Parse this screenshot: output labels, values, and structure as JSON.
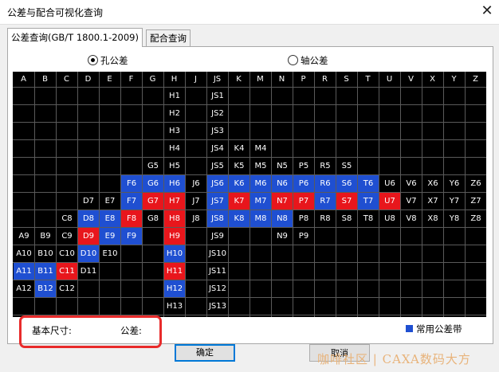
{
  "window": {
    "title": "公差与配合可视化查询",
    "close_glyph": "✕"
  },
  "tabs": [
    {
      "label": "公差查询(GB/T 1800.1-2009)",
      "active": true
    },
    {
      "label": "配合查询",
      "active": false
    }
  ],
  "radios": [
    {
      "label": "孔公差",
      "checked": true
    },
    {
      "label": "轴公差",
      "checked": false
    }
  ],
  "grid": {
    "columns": [
      "A",
      "B",
      "C",
      "D",
      "E",
      "F",
      "G",
      "H",
      "J",
      "JS",
      "K",
      "M",
      "N",
      "P",
      "R",
      "S",
      "T",
      "U",
      "V",
      "X",
      "Y",
      "Z"
    ],
    "colors": {
      "blue": "#1f4fd1",
      "red": "#e8161c"
    },
    "cells": [
      {
        "r": 0,
        "c": 7,
        "t": "H1"
      },
      {
        "r": 0,
        "c": 9,
        "t": "JS1"
      },
      {
        "r": 1,
        "c": 7,
        "t": "H2"
      },
      {
        "r": 1,
        "c": 9,
        "t": "JS2"
      },
      {
        "r": 2,
        "c": 7,
        "t": "H3"
      },
      {
        "r": 2,
        "c": 9,
        "t": "JS3"
      },
      {
        "r": 3,
        "c": 7,
        "t": "H4"
      },
      {
        "r": 3,
        "c": 9,
        "t": "JS4"
      },
      {
        "r": 3,
        "c": 10,
        "t": "K4"
      },
      {
        "r": 3,
        "c": 11,
        "t": "M4"
      },
      {
        "r": 4,
        "c": 6,
        "t": "G5"
      },
      {
        "r": 4,
        "c": 7,
        "t": "H5"
      },
      {
        "r": 4,
        "c": 9,
        "t": "JS5"
      },
      {
        "r": 4,
        "c": 10,
        "t": "K5"
      },
      {
        "r": 4,
        "c": 11,
        "t": "M5"
      },
      {
        "r": 4,
        "c": 12,
        "t": "N5"
      },
      {
        "r": 4,
        "c": 13,
        "t": "P5"
      },
      {
        "r": 4,
        "c": 14,
        "t": "R5"
      },
      {
        "r": 4,
        "c": 15,
        "t": "S5"
      },
      {
        "r": 5,
        "c": 5,
        "t": "F6",
        "k": "blue"
      },
      {
        "r": 5,
        "c": 6,
        "t": "G6",
        "k": "blue"
      },
      {
        "r": 5,
        "c": 7,
        "t": "H6",
        "k": "blue"
      },
      {
        "r": 5,
        "c": 8,
        "t": "J6"
      },
      {
        "r": 5,
        "c": 9,
        "t": "JS6",
        "k": "blue"
      },
      {
        "r": 5,
        "c": 10,
        "t": "K6",
        "k": "blue"
      },
      {
        "r": 5,
        "c": 11,
        "t": "M6",
        "k": "blue"
      },
      {
        "r": 5,
        "c": 12,
        "t": "N6",
        "k": "blue"
      },
      {
        "r": 5,
        "c": 13,
        "t": "P6",
        "k": "blue"
      },
      {
        "r": 5,
        "c": 14,
        "t": "R6",
        "k": "blue"
      },
      {
        "r": 5,
        "c": 15,
        "t": "S6",
        "k": "blue"
      },
      {
        "r": 5,
        "c": 16,
        "t": "T6",
        "k": "blue"
      },
      {
        "r": 5,
        "c": 17,
        "t": "U6"
      },
      {
        "r": 5,
        "c": 18,
        "t": "V6"
      },
      {
        "r": 5,
        "c": 19,
        "t": "X6"
      },
      {
        "r": 5,
        "c": 20,
        "t": "Y6"
      },
      {
        "r": 5,
        "c": 21,
        "t": "Z6"
      },
      {
        "r": 6,
        "c": 3,
        "t": "D7"
      },
      {
        "r": 6,
        "c": 4,
        "t": "E7"
      },
      {
        "r": 6,
        "c": 5,
        "t": "F7",
        "k": "blue"
      },
      {
        "r": 6,
        "c": 6,
        "t": "G7",
        "k": "red"
      },
      {
        "r": 6,
        "c": 7,
        "t": "H7",
        "k": "red"
      },
      {
        "r": 6,
        "c": 8,
        "t": "J7"
      },
      {
        "r": 6,
        "c": 9,
        "t": "JS7",
        "k": "blue"
      },
      {
        "r": 6,
        "c": 10,
        "t": "K7",
        "k": "red"
      },
      {
        "r": 6,
        "c": 11,
        "t": "M7",
        "k": "blue"
      },
      {
        "r": 6,
        "c": 12,
        "t": "N7",
        "k": "red"
      },
      {
        "r": 6,
        "c": 13,
        "t": "P7",
        "k": "red"
      },
      {
        "r": 6,
        "c": 14,
        "t": "R7",
        "k": "blue"
      },
      {
        "r": 6,
        "c": 15,
        "t": "S7",
        "k": "red"
      },
      {
        "r": 6,
        "c": 16,
        "t": "T7",
        "k": "blue"
      },
      {
        "r": 6,
        "c": 17,
        "t": "U7",
        "k": "red"
      },
      {
        "r": 6,
        "c": 18,
        "t": "V7"
      },
      {
        "r": 6,
        "c": 19,
        "t": "X7"
      },
      {
        "r": 6,
        "c": 20,
        "t": "Y7"
      },
      {
        "r": 6,
        "c": 21,
        "t": "Z7"
      },
      {
        "r": 7,
        "c": 2,
        "t": "C8"
      },
      {
        "r": 7,
        "c": 3,
        "t": "D8",
        "k": "blue"
      },
      {
        "r": 7,
        "c": 4,
        "t": "E8",
        "k": "blue"
      },
      {
        "r": 7,
        "c": 5,
        "t": "F8",
        "k": "red"
      },
      {
        "r": 7,
        "c": 6,
        "t": "G8"
      },
      {
        "r": 7,
        "c": 7,
        "t": "H8",
        "k": "red"
      },
      {
        "r": 7,
        "c": 8,
        "t": "J8"
      },
      {
        "r": 7,
        "c": 9,
        "t": "JS8",
        "k": "blue"
      },
      {
        "r": 7,
        "c": 10,
        "t": "K8",
        "k": "blue"
      },
      {
        "r": 7,
        "c": 11,
        "t": "M8",
        "k": "blue"
      },
      {
        "r": 7,
        "c": 12,
        "t": "N8",
        "k": "blue"
      },
      {
        "r": 7,
        "c": 13,
        "t": "P8"
      },
      {
        "r": 7,
        "c": 14,
        "t": "R8"
      },
      {
        "r": 7,
        "c": 15,
        "t": "S8"
      },
      {
        "r": 7,
        "c": 16,
        "t": "T8"
      },
      {
        "r": 7,
        "c": 17,
        "t": "U8"
      },
      {
        "r": 7,
        "c": 18,
        "t": "V8"
      },
      {
        "r": 7,
        "c": 19,
        "t": "X8"
      },
      {
        "r": 7,
        "c": 20,
        "t": "Y8"
      },
      {
        "r": 7,
        "c": 21,
        "t": "Z8"
      },
      {
        "r": 8,
        "c": 0,
        "t": "A9"
      },
      {
        "r": 8,
        "c": 1,
        "t": "B9"
      },
      {
        "r": 8,
        "c": 2,
        "t": "C9"
      },
      {
        "r": 8,
        "c": 3,
        "t": "D9",
        "k": "red"
      },
      {
        "r": 8,
        "c": 4,
        "t": "E9",
        "k": "blue"
      },
      {
        "r": 8,
        "c": 5,
        "t": "F9",
        "k": "blue"
      },
      {
        "r": 8,
        "c": 7,
        "t": "H9",
        "k": "red"
      },
      {
        "r": 8,
        "c": 9,
        "t": "JS9"
      },
      {
        "r": 8,
        "c": 12,
        "t": "N9"
      },
      {
        "r": 8,
        "c": 13,
        "t": "P9"
      },
      {
        "r": 9,
        "c": 0,
        "t": "A10"
      },
      {
        "r": 9,
        "c": 1,
        "t": "B10"
      },
      {
        "r": 9,
        "c": 2,
        "t": "C10"
      },
      {
        "r": 9,
        "c": 3,
        "t": "D10",
        "k": "blue"
      },
      {
        "r": 9,
        "c": 4,
        "t": "E10"
      },
      {
        "r": 9,
        "c": 7,
        "t": "H10",
        "k": "blue"
      },
      {
        "r": 9,
        "c": 9,
        "t": "JS10"
      },
      {
        "r": 10,
        "c": 0,
        "t": "A11",
        "k": "blue"
      },
      {
        "r": 10,
        "c": 1,
        "t": "B11",
        "k": "blue"
      },
      {
        "r": 10,
        "c": 2,
        "t": "C11",
        "k": "red"
      },
      {
        "r": 10,
        "c": 3,
        "t": "D11"
      },
      {
        "r": 10,
        "c": 7,
        "t": "H11",
        "k": "red"
      },
      {
        "r": 10,
        "c": 9,
        "t": "JS11"
      },
      {
        "r": 11,
        "c": 0,
        "t": "A12"
      },
      {
        "r": 11,
        "c": 1,
        "t": "B12",
        "k": "blue"
      },
      {
        "r": 11,
        "c": 2,
        "t": "C12"
      },
      {
        "r": 11,
        "c": 7,
        "t": "H12",
        "k": "blue"
      },
      {
        "r": 11,
        "c": 9,
        "t": "JS12"
      },
      {
        "r": 12,
        "c": 7,
        "t": "H13"
      },
      {
        "r": 12,
        "c": 9,
        "t": "JS13"
      }
    ]
  },
  "info": {
    "basic_size_label": "基本尺寸:",
    "tolerance_label": "公差:"
  },
  "legend": {
    "label": "常用公差带"
  },
  "buttons": {
    "ok": "确定",
    "cancel": "取消"
  },
  "watermark": "咖啡社区 | CAXA数码大方"
}
